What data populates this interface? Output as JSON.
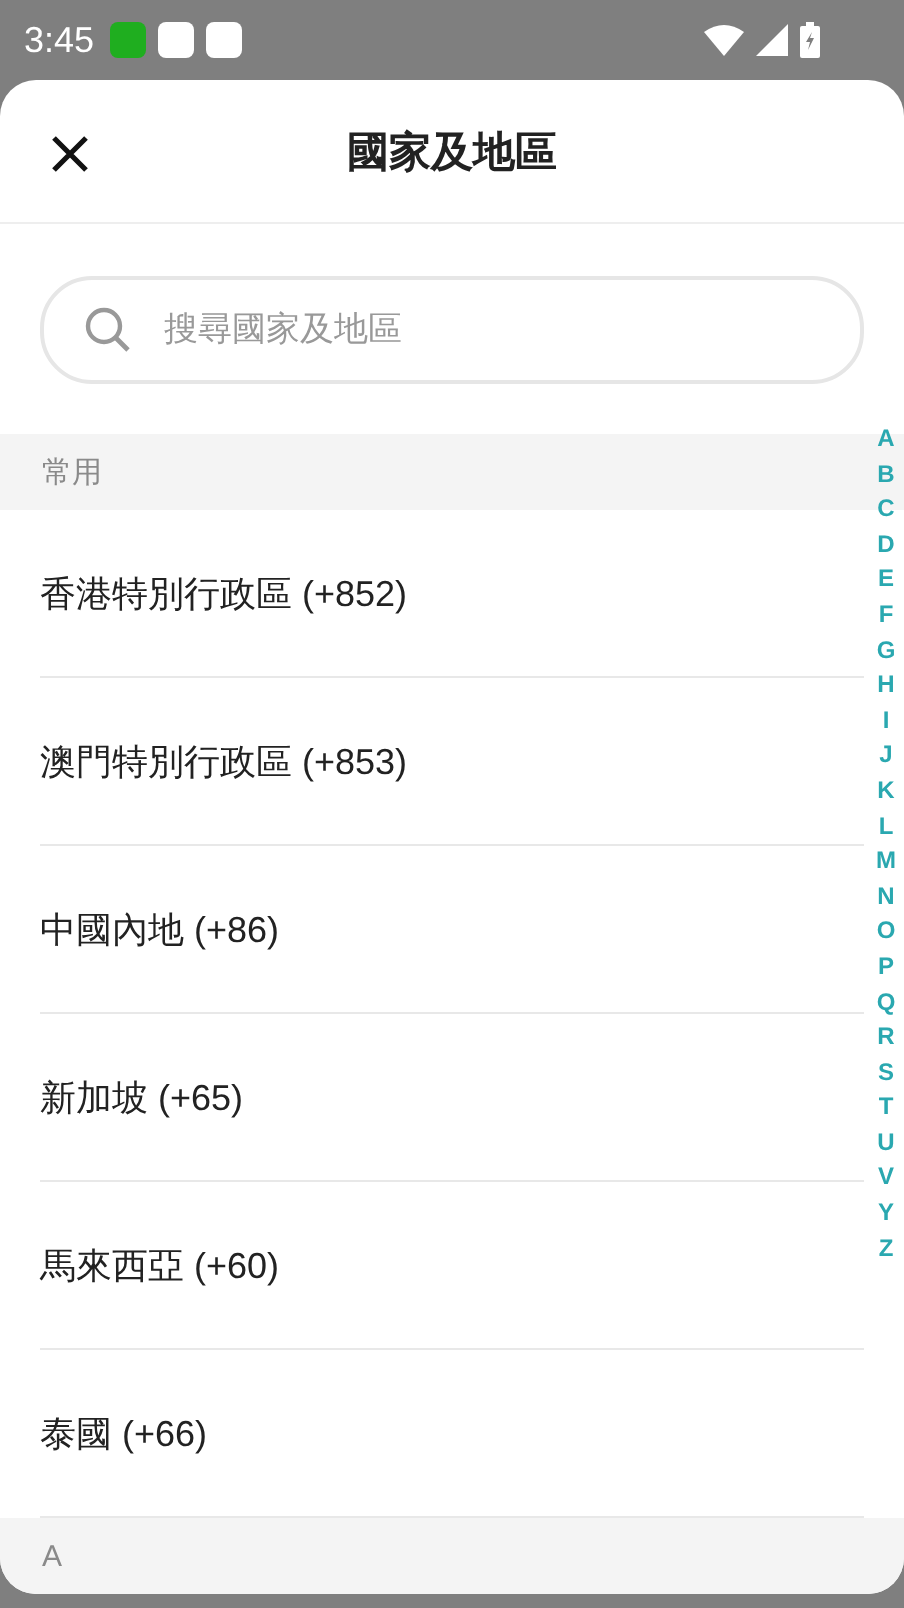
{
  "status_bar": {
    "time": "3:45"
  },
  "header": {
    "title": "國家及地區"
  },
  "search": {
    "placeholder": "搜尋國家及地區"
  },
  "sections": [
    {
      "title": "常用",
      "items": [
        {
          "label": "香港特別行政區 (+852)"
        },
        {
          "label": "澳門特別行政區 (+853)"
        },
        {
          "label": "中國內地 (+86)"
        },
        {
          "label": "新加坡 (+65)"
        },
        {
          "label": "馬來西亞 (+60)"
        },
        {
          "label": "泰國 (+66)"
        }
      ]
    },
    {
      "title": "A"
    }
  ],
  "index": [
    "A",
    "B",
    "C",
    "D",
    "E",
    "F",
    "G",
    "H",
    "I",
    "J",
    "K",
    "L",
    "M",
    "N",
    "O",
    "P",
    "Q",
    "R",
    "S",
    "T",
    "U",
    "V",
    "Y",
    "Z"
  ]
}
